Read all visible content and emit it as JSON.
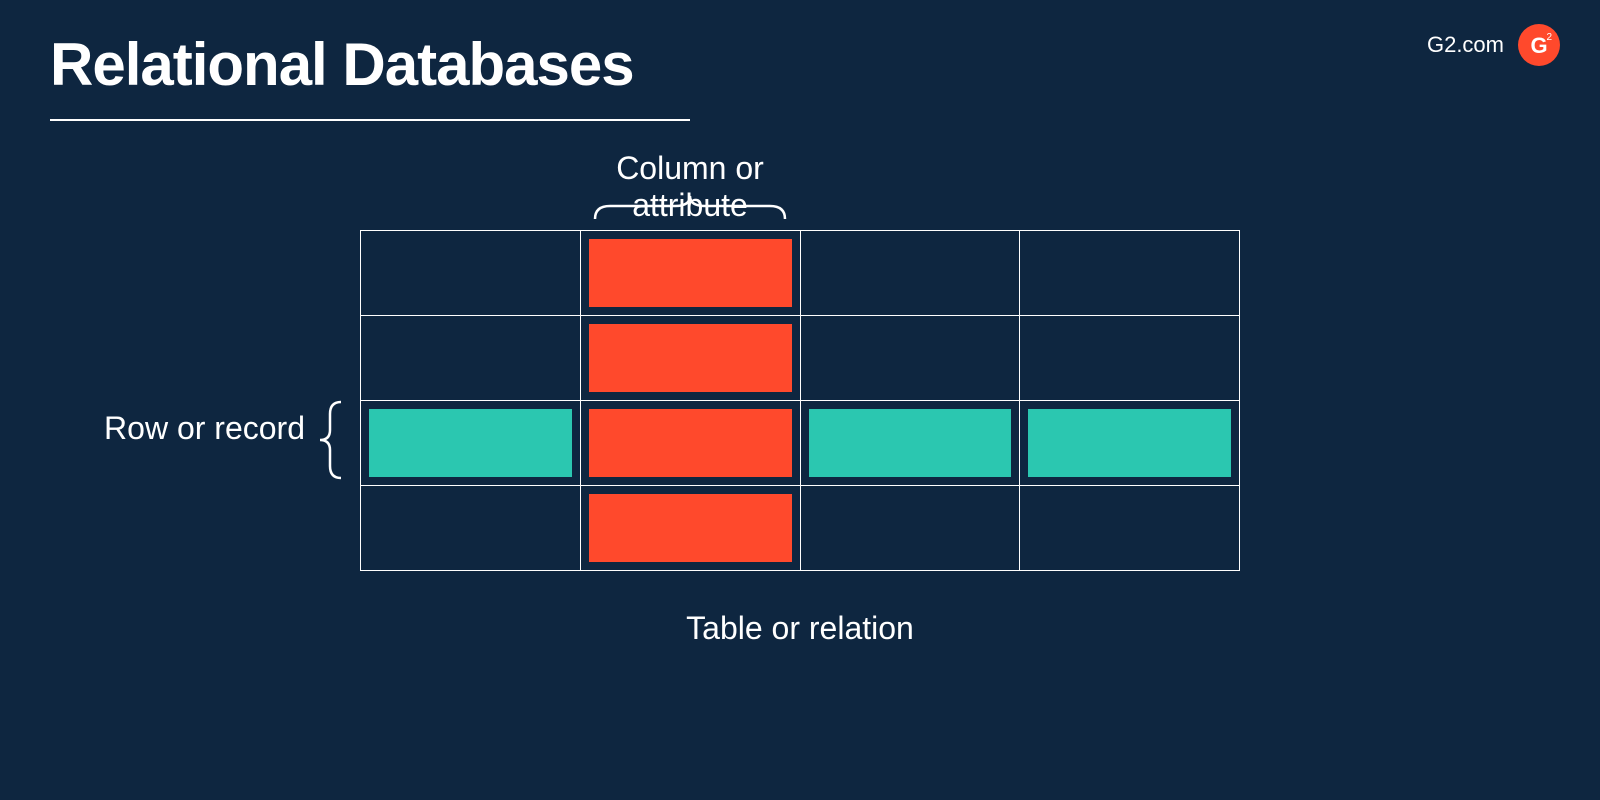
{
  "title": "Relational Databases",
  "brand": {
    "text": "G2.com",
    "logo_letter": "G",
    "logo_superscript": "2",
    "logo_color": "#ff492c"
  },
  "labels": {
    "column": "Column or attribute",
    "row": "Row or record",
    "table": "Table or relation"
  },
  "grid": {
    "rows": 4,
    "cols": 4,
    "highlighted_column_index": 1,
    "highlighted_row_index": 2,
    "column_highlight_color": "#ff492c",
    "row_highlight_color": "#2bc7b0"
  },
  "colors": {
    "background": "#0e2640",
    "text": "#ffffff",
    "orange": "#ff492c",
    "teal": "#2bc7b0"
  }
}
